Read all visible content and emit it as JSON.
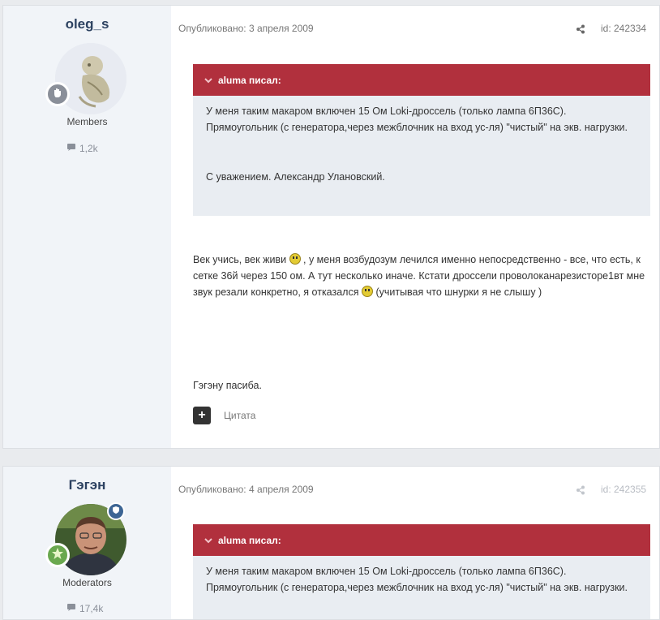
{
  "posts": [
    {
      "author": {
        "name": "oleg_s",
        "group": "Members",
        "post_count": "1,2k",
        "rank_icon": "hand-icon",
        "rank_color": "#8a8f99"
      },
      "meta": {
        "published": "Опубликовано: 3 апреля 2009",
        "post_id": "id: 242334"
      },
      "quote": {
        "header": "aluma писал:",
        "paragraphs": [
          "У меня таким макаром включен 15 Ом Loki-дроссель (только лампа 6П36С). Прямоугольник (с генератора,через межблочник на вход ус-ля) \"чистый\" на экв. нагрузки.",
          "С уважением. Александр Улановский."
        ]
      },
      "body": {
        "p1a": "Век учись, век живи ",
        "p1b": " , у меня возбудозум лечился именно непосредственно - все, что есть, к сетке 36й через 150 ом. А тут несколько иначе. Кстати дроссели проволоканарезисторе1вт мне звук резали конкретно, я отказался ",
        "p1c": " (учитывая что шнурки я не слышу )",
        "p2": "Гэгэну пасиба."
      },
      "actions": {
        "react": "+",
        "quote": "Цитата"
      }
    },
    {
      "author": {
        "name": "Гэгэн",
        "group": "Moderators",
        "post_count": "17,4k",
        "rank_icon": "star-icon",
        "rank_color": "#6aa84f",
        "mod_icon": "shield-icon",
        "mod_color": "#3d6594"
      },
      "meta": {
        "published": "Опубликовано: 4 апреля 2009",
        "post_id": "id: 242355"
      },
      "quote": {
        "header": "aluma писал:",
        "paragraphs": [
          "У меня таким макаром включен 15 Ом Loki-дроссель (только лампа 6П36С). Прямоугольник (с генератора,через межблочник на вход ус-ля) \"чистый\" на экв. нагрузки."
        ]
      }
    }
  ],
  "colors": {
    "quote_header": "#b1303d",
    "author_bg": "#f1f4f8",
    "username": "#2d4261"
  }
}
